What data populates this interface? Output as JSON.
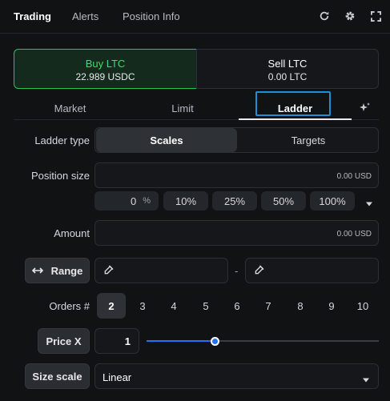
{
  "top_tabs": [
    {
      "label": "Trading",
      "active": true
    },
    {
      "label": "Alerts",
      "active": false
    },
    {
      "label": "Position Info",
      "active": false
    }
  ],
  "top_icons": [
    "refresh-icon",
    "gear-icon",
    "expand-icon"
  ],
  "sides": {
    "buy": {
      "title": "Buy LTC",
      "amount": "22.989 USDC"
    },
    "sell": {
      "title": "Sell LTC",
      "amount": "0.00 LTC"
    }
  },
  "order_tabs": [
    {
      "label": "Market",
      "active": false
    },
    {
      "label": "Limit",
      "active": false
    },
    {
      "label": "Ladder",
      "active": true
    }
  ],
  "ladder_type": {
    "label": "Ladder type",
    "options": [
      "Scales",
      "Targets"
    ],
    "selected": "Scales"
  },
  "position_size": {
    "label": "Position size",
    "value": "0.00 USD",
    "percent_value": "0",
    "percent_symbol": "%",
    "presets": [
      "10%",
      "25%",
      "50%",
      "100%"
    ]
  },
  "amount": {
    "label": "Amount",
    "value": "0.00 USD"
  },
  "range": {
    "label": "Range",
    "separator": "-"
  },
  "orders": {
    "label": "Orders #",
    "options": [
      "2",
      "3",
      "4",
      "5",
      "6",
      "7",
      "8",
      "9",
      "10"
    ],
    "selected": "2"
  },
  "price_x": {
    "label": "Price X",
    "value": "1",
    "slider_fraction": 0.3
  },
  "size_scale": {
    "label": "Size scale",
    "value": "Linear"
  },
  "colors": {
    "accent_blue": "#2a6ff0",
    "buy_green": "#3ddc6e",
    "focus": "#1e8fd6"
  }
}
